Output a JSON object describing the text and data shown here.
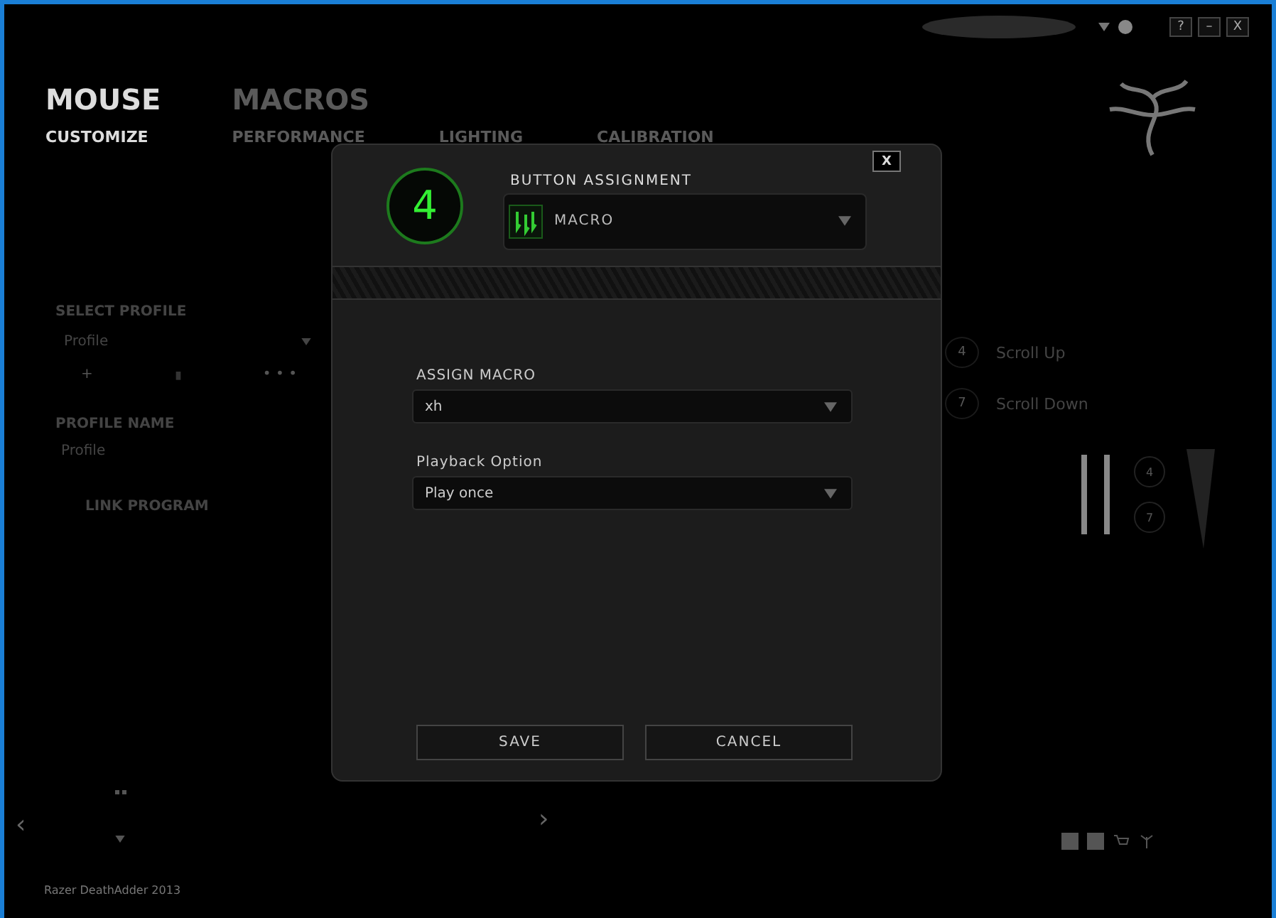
{
  "header": {
    "section": "MOUSE",
    "subtab": "CUSTOMIZE",
    "tabs": [
      {
        "label": "MACROS",
        "selected": false
      }
    ],
    "subtabs": [
      {
        "label": "PERFORMANCE"
      },
      {
        "label": "LIGHTING"
      },
      {
        "label": "CALIBRATION"
      }
    ],
    "window_buttons": [
      "?",
      "–",
      "X"
    ]
  },
  "sidebar": {
    "select_profile_label": "SELECT PROFILE",
    "profile": "Profile",
    "add": "+",
    "more": "• • •",
    "profile_name_label": "PROFILE NAME",
    "profile_name": "Profile",
    "link_program": "LINK PROGRAM"
  },
  "assignments": [
    {
      "button": "4",
      "action": "Scroll Up"
    },
    {
      "button": "7",
      "action": "Scroll Down"
    }
  ],
  "mouse_side_buttons": [
    "4",
    "7"
  ],
  "nav": {
    "prev": "‹",
    "next": "›"
  },
  "device_name": "Razer DeathAdder 2013",
  "dialog": {
    "close": "X",
    "button_number": "4",
    "title": "BUTTON ASSIGNMENT",
    "assignment": "MACRO",
    "fields": [
      {
        "label": "ASSIGN MACRO",
        "value": "xh"
      },
      {
        "label": "Playback Option",
        "value": "Play once"
      }
    ],
    "buttons": [
      "SAVE",
      "CANCEL"
    ]
  }
}
